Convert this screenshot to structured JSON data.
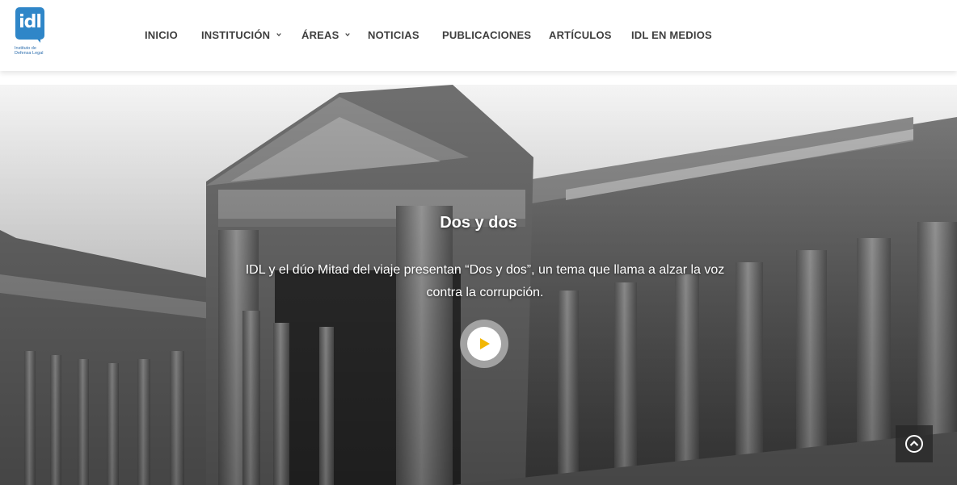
{
  "brand": {
    "logo_text": "idl",
    "caption": "Instituto de Defensa Legal",
    "color": "#2f86c8"
  },
  "nav": {
    "items": [
      {
        "label": "INICIO",
        "dropdown": false
      },
      {
        "label": "INSTITUCIÓN",
        "dropdown": true
      },
      {
        "label": "ÁREAS",
        "dropdown": true
      },
      {
        "label": "NOTICIAS",
        "dropdown": false
      },
      {
        "label": "PUBLICACIONES",
        "dropdown": false
      },
      {
        "label": "ARTÍCULOS",
        "dropdown": false
      },
      {
        "label": "IDL EN MEDIOS",
        "dropdown": false
      }
    ]
  },
  "hero": {
    "title": "Dos y dos",
    "description": "IDL y el dúo Mitad del viaje presentan “Dos y dos”, un tema que llama a alzar la voz contra la corrupción.",
    "play_icon": "play-icon",
    "accent_color": "#f2b705"
  },
  "scroll_top_icon": "chevron-up-circle-icon"
}
